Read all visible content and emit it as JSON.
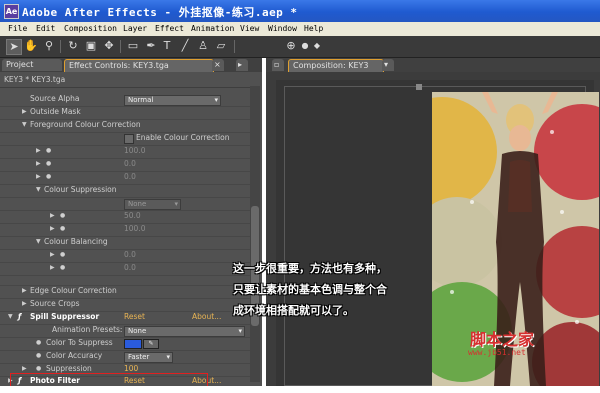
{
  "window": {
    "title": "Adobe After Effects - 外挂抠像-练习.aep *"
  },
  "menu": [
    "File",
    "Edit",
    "Composition",
    "Layer",
    "Effect",
    "Animation",
    "View",
    "Window",
    "Help"
  ],
  "tabs": {
    "project": "Project",
    "effect_controls": "Effect Controls: KEY3.tga",
    "composition": "Composition: KEY3"
  },
  "layer_header": "KEY3 * KEY3.tga",
  "effect_rows": {
    "source_alpha": {
      "label": "Source Alpha",
      "value": "Normal"
    },
    "outside_mask": "Outside Mask",
    "foreground_colour_correction": "Foreground Colour Correction",
    "enable_colour_correction": "Enable Colour Correction",
    "fg_values": [
      "100.0",
      "0.0",
      "0.0"
    ],
    "colour_suppression": "Colour Suppression",
    "cs_dropdown": "None",
    "cs_values": [
      "50.0",
      "100.0"
    ],
    "colour_balancing": "Colour Balancing",
    "cb_values": [
      "0.0",
      "0.0"
    ],
    "edge_colour_correction": "Edge Colour Correction",
    "source_crops": "Source Crops"
  },
  "spill": {
    "name": "Spill Suppressor",
    "reset": "Reset",
    "about": "About...",
    "presets_label": "Animation Presets:",
    "presets_value": "None",
    "color_label": "Color To Suppress",
    "accuracy_label": "Color Accuracy",
    "accuracy_value": "Faster",
    "suppression_label": "Suppression",
    "suppression_value": "100",
    "swatch": "#2a5bdc"
  },
  "photo_filter": {
    "name": "Photo Filter",
    "reset": "Reset",
    "about": "About..."
  },
  "caption": [
    "这一步很重要，方法也有多种，",
    "只要让素材的基本色调与整个合",
    "成环境相搭配就可以了。"
  ],
  "watermark": {
    "main": "脚本之家",
    "url": "www.jb51.net"
  }
}
